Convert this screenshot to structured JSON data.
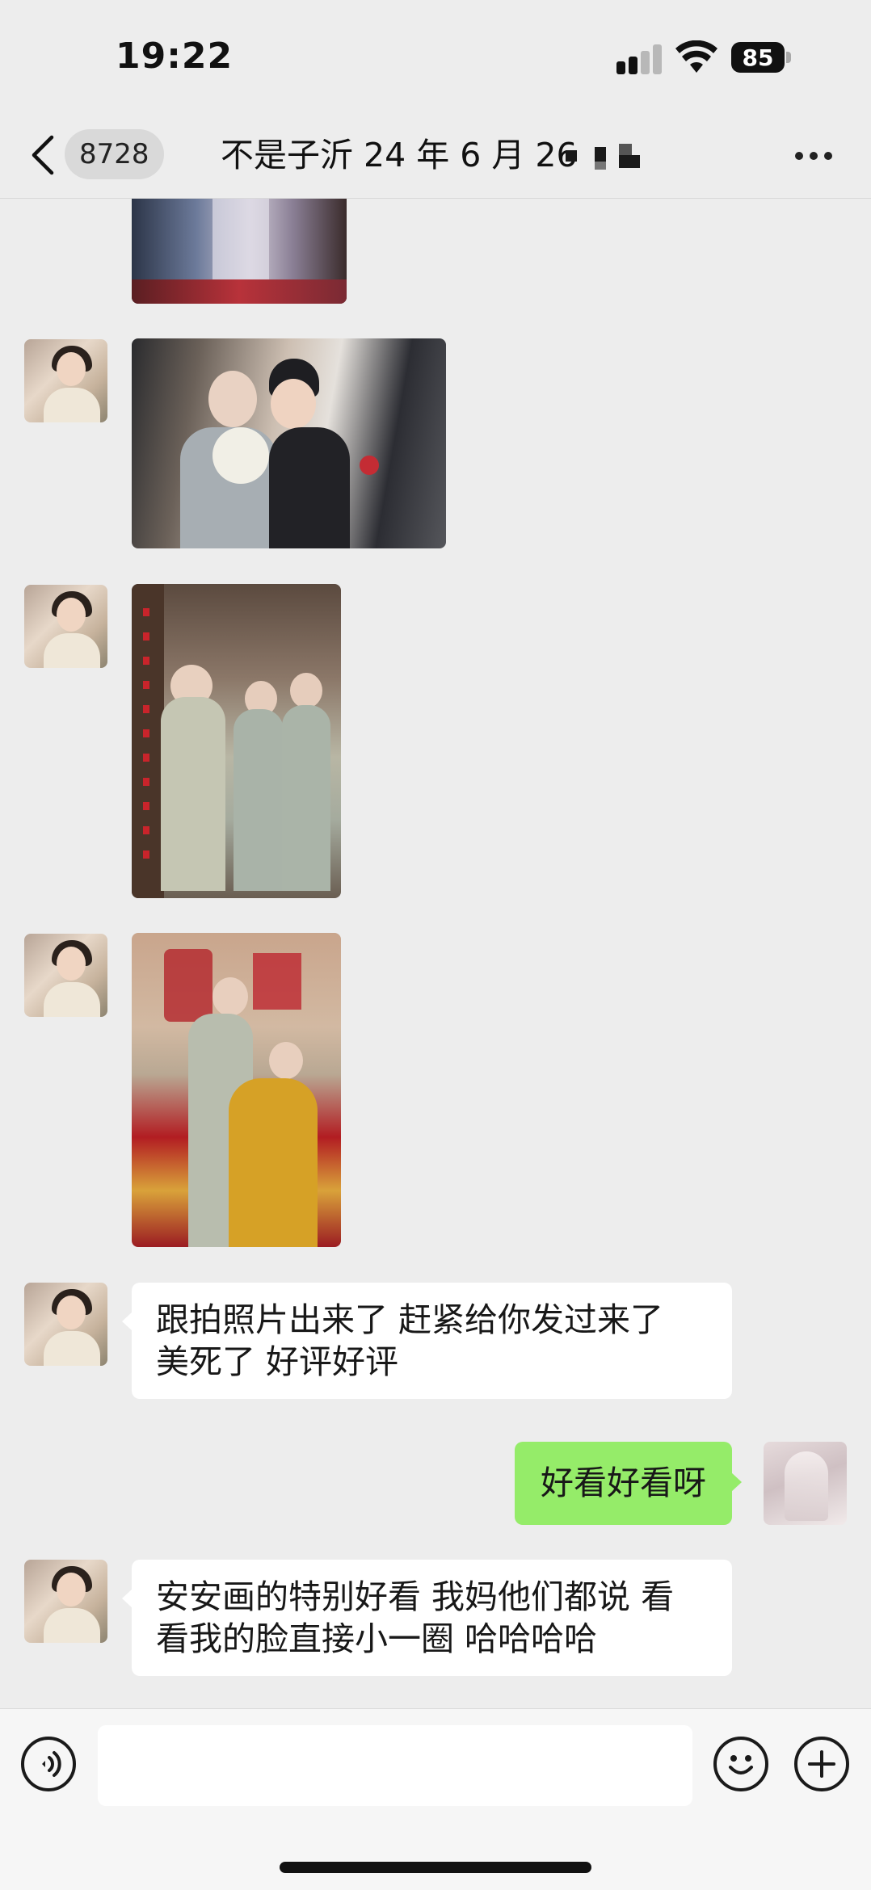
{
  "status_bar": {
    "time": "19:22",
    "battery": "85",
    "signal_bars_active": 2,
    "signal_bars_total": 4
  },
  "nav": {
    "back_icon": "chevron-left-icon",
    "unread_count": "8728",
    "title": "不是子沂 24 年 6 月 26",
    "more_icon": "more-icon"
  },
  "messages": [
    {
      "type": "image",
      "sender": "other",
      "description": "photo-partial"
    },
    {
      "type": "image",
      "sender": "other",
      "description": "photo-couple-car"
    },
    {
      "type": "image",
      "sender": "other",
      "description": "photo-bride-bridesmaids"
    },
    {
      "type": "image",
      "sender": "other",
      "description": "photo-bride-mother"
    },
    {
      "type": "text",
      "sender": "other",
      "lines": [
        "跟拍照片出来了 赶紧给你发过来了",
        "美死了  好评好评"
      ]
    },
    {
      "type": "text",
      "sender": "me",
      "text": "好看好看呀"
    },
    {
      "type": "text",
      "sender": "other",
      "lines": [
        "安安画的特别好看  我妈他们都说 看",
        "看我的脸直接小一圈  哈哈哈哈"
      ]
    }
  ],
  "input_bar": {
    "voice_icon": "voice-icon",
    "emoji_icon": "emoji-icon",
    "plus_icon": "plus-icon",
    "placeholder": ""
  },
  "colors": {
    "background": "#ededed",
    "outgoing_bubble": "#95ec69",
    "incoming_bubble": "#ffffff"
  }
}
